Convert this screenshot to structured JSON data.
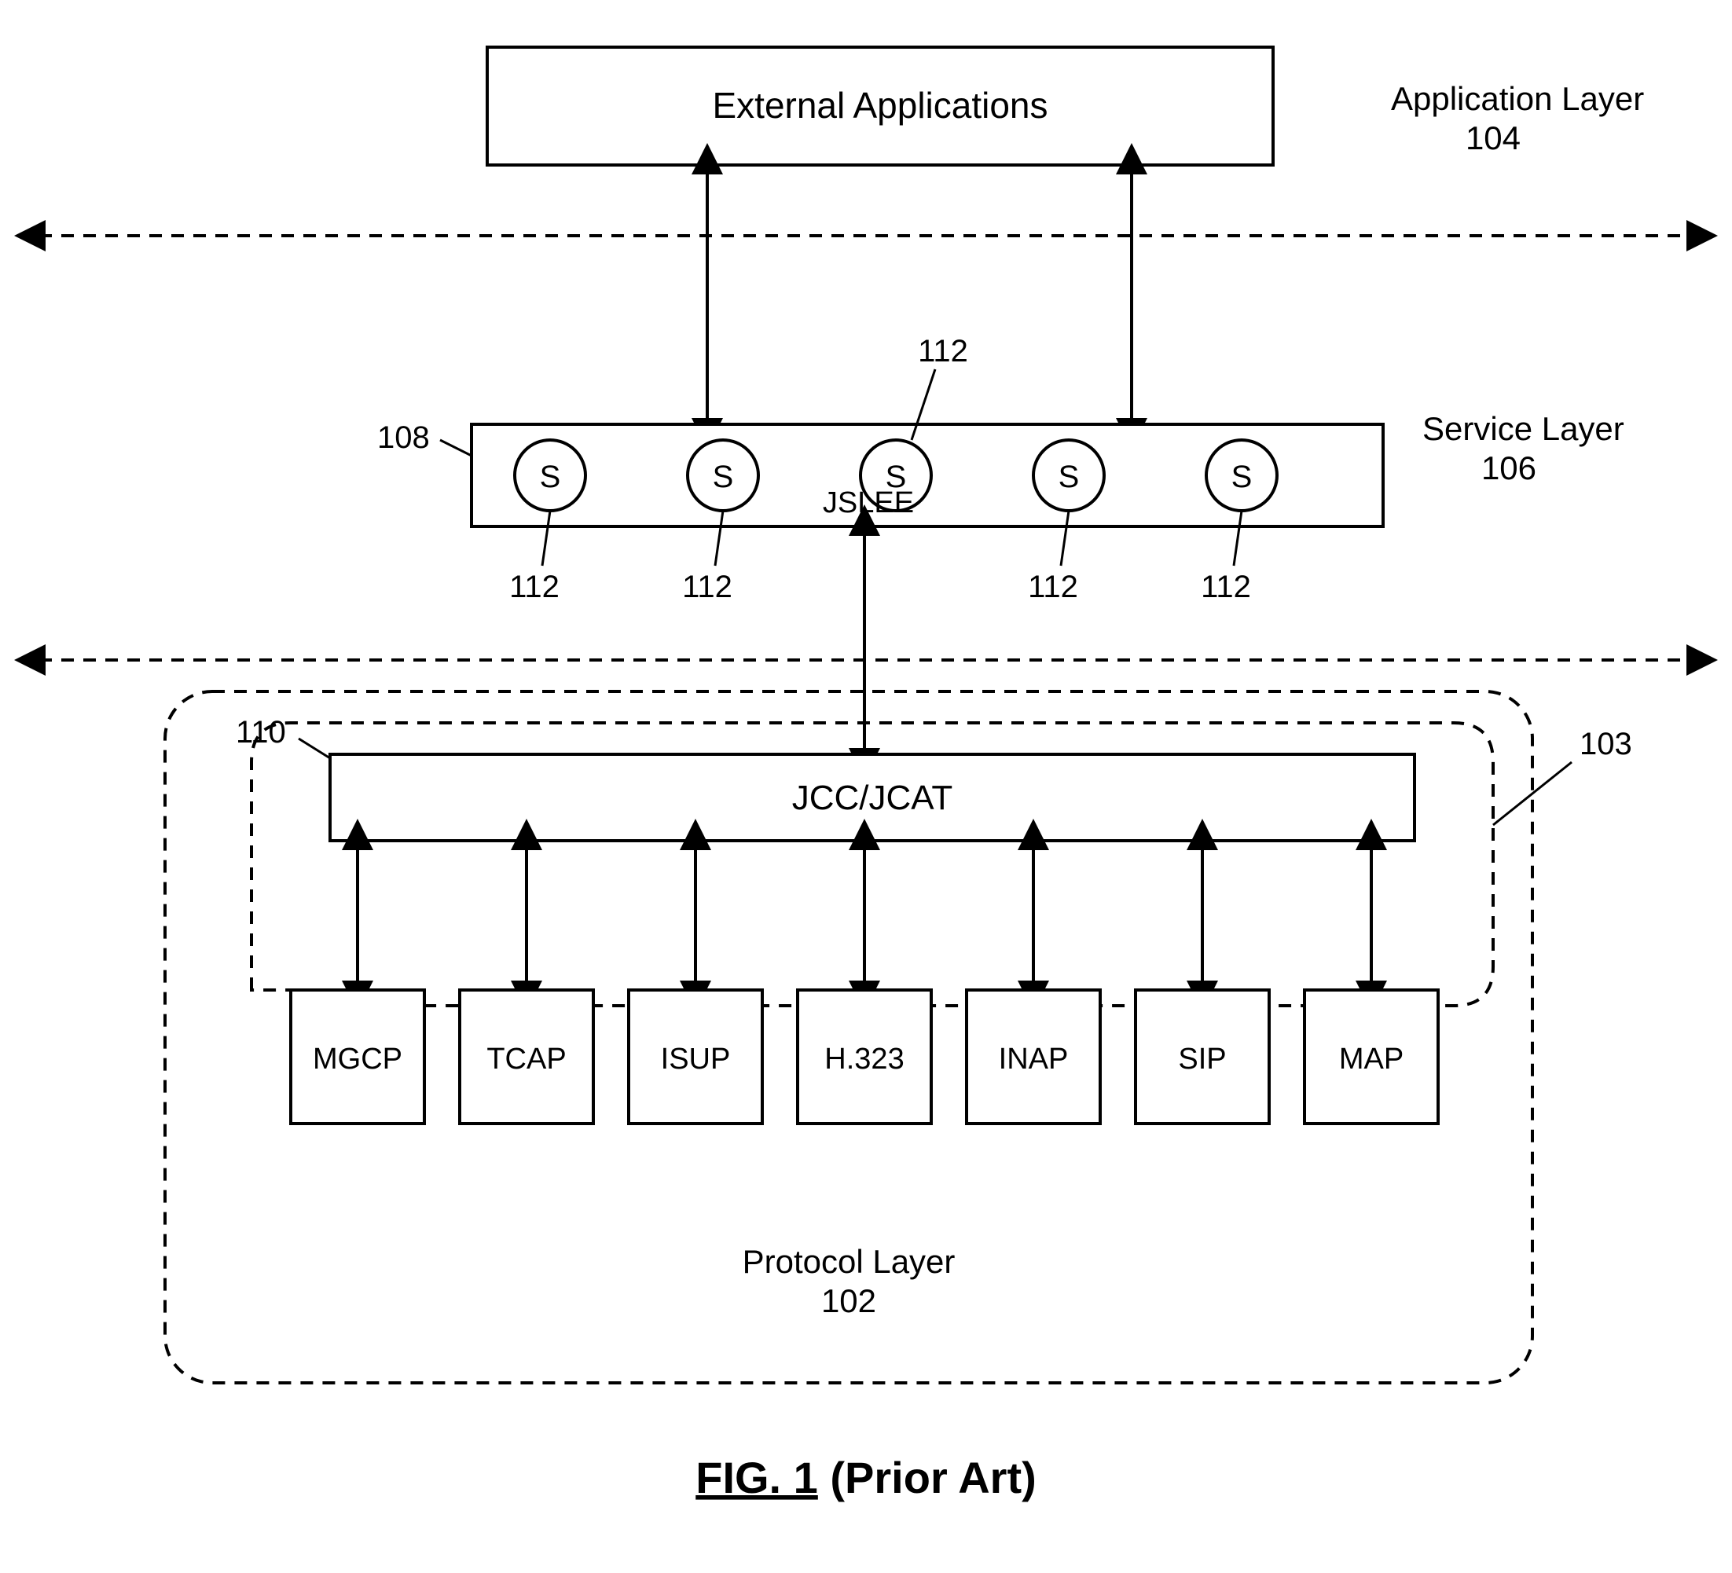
{
  "layers": {
    "application": {
      "label": "Application Layer",
      "ref": "104"
    },
    "service": {
      "label": "Service Layer",
      "ref": "106"
    },
    "protocol": {
      "label": "Protocol Layer",
      "ref": "102"
    }
  },
  "blocks": {
    "external_apps": {
      "label": "External Applications"
    },
    "jslee": {
      "label": "JSLEE",
      "ref": "108"
    },
    "jcc": {
      "label": "JCC/JCAT",
      "ref": "110"
    }
  },
  "services": {
    "label": "S",
    "ref": "112"
  },
  "protocols": [
    "MGCP",
    "TCAP",
    "ISUP",
    "H.323",
    "INAP",
    "SIP",
    "MAP"
  ],
  "refs": {
    "inner_group": "103"
  },
  "caption": {
    "fig": "FIG. 1",
    "note": "(Prior Art)"
  }
}
